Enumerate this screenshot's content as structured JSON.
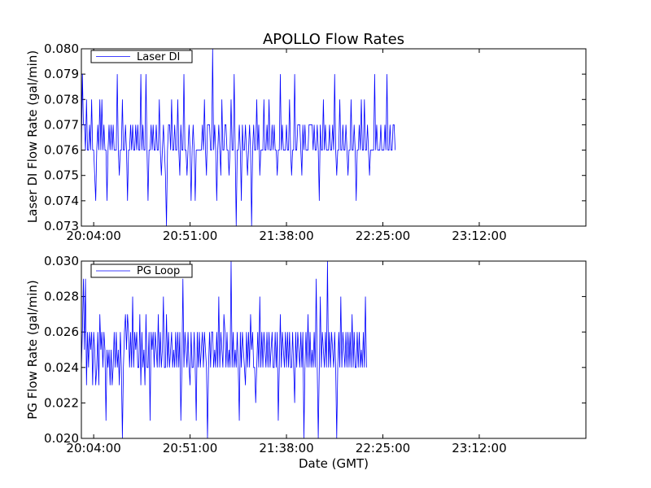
{
  "chart_data": [
    {
      "type": "line",
      "title": "APOLLO Flow Rates",
      "xlabel": "",
      "ylabel": "Laser DI Flow Rate (gal/min)",
      "ylim": [
        0.073,
        0.08
      ],
      "yticks": [
        "0.073",
        "0.074",
        "0.075",
        "0.076",
        "0.077",
        "0.078",
        "0.079",
        "0.080"
      ],
      "xlim": [
        "19:58:00",
        "00:04:00"
      ],
      "xticks": [
        "20:04:00",
        "20:51:00",
        "21:38:00",
        "22:25:00",
        "23:12:00"
      ],
      "grid": false,
      "legend": "upper-left",
      "series": [
        {
          "name": "Laser DI",
          "color": "#0000ff",
          "time_interval_min": 0.5,
          "values": [
            0.076,
            0.079,
            0.077,
            0.077,
            0.076,
            0.078,
            0.076,
            0.076,
            0.077,
            0.076,
            0.078,
            0.076,
            0.076,
            0.075,
            0.074,
            0.076,
            0.077,
            0.076,
            0.078,
            0.076,
            0.078,
            0.076,
            0.077,
            0.076,
            0.076,
            0.074,
            0.076,
            0.077,
            0.076,
            0.077,
            0.076,
            0.077,
            0.076,
            0.076,
            0.076,
            0.079,
            0.076,
            0.075,
            0.076,
            0.076,
            0.078,
            0.076,
            0.076,
            0.077,
            0.076,
            0.074,
            0.076,
            0.076,
            0.077,
            0.076,
            0.077,
            0.076,
            0.076,
            0.077,
            0.076,
            0.077,
            0.076,
            0.076,
            0.079,
            0.076,
            0.077,
            0.076,
            0.076,
            0.079,
            0.076,
            0.074,
            0.076,
            0.076,
            0.077,
            0.076,
            0.077,
            0.076,
            0.076,
            0.077,
            0.076,
            0.076,
            0.078,
            0.076,
            0.075,
            0.076,
            0.077,
            0.076,
            0.075,
            0.073,
            0.076,
            0.077,
            0.077,
            0.076,
            0.078,
            0.076,
            0.076,
            0.077,
            0.076,
            0.076,
            0.078,
            0.076,
            0.075,
            0.077,
            0.076,
            0.076,
            0.079,
            0.076,
            0.076,
            0.075,
            0.076,
            0.077,
            0.076,
            0.074,
            0.076,
            0.077,
            0.076,
            0.074,
            0.076,
            0.076,
            0.076,
            0.076,
            0.076,
            0.076,
            0.077,
            0.076,
            0.078,
            0.076,
            0.075,
            0.077,
            0.077,
            0.077,
            0.076,
            0.076,
            0.08,
            0.076,
            0.077,
            0.076,
            0.074,
            0.076,
            0.077,
            0.076,
            0.075,
            0.078,
            0.076,
            0.076,
            0.077,
            0.077,
            0.076,
            0.076,
            0.075,
            0.076,
            0.078,
            0.076,
            0.076,
            0.079,
            0.076,
            0.073,
            0.076,
            0.076,
            0.077,
            0.076,
            0.074,
            0.077,
            0.076,
            0.076,
            0.077,
            0.076,
            0.075,
            0.076,
            0.077,
            0.076,
            0.073,
            0.076,
            0.077,
            0.076,
            0.076,
            0.078,
            0.076,
            0.077,
            0.075,
            0.076,
            0.076,
            0.076,
            0.078,
            0.076,
            0.076,
            0.077,
            0.076,
            0.078,
            0.076,
            0.076,
            0.077,
            0.076,
            0.077,
            0.076,
            0.076,
            0.075,
            0.076,
            0.076,
            0.079,
            0.076,
            0.077,
            0.076,
            0.076,
            0.076,
            0.077,
            0.076,
            0.076,
            0.078,
            0.076,
            0.075,
            0.076,
            0.076,
            0.079,
            0.076,
            0.076,
            0.077,
            0.077,
            0.077,
            0.076,
            0.075,
            0.077,
            0.076,
            0.077,
            0.076,
            0.076,
            0.076,
            0.077,
            0.077,
            0.077,
            0.077,
            0.076,
            0.077,
            0.076,
            0.076,
            0.077,
            0.076,
            0.074,
            0.077,
            0.076,
            0.076,
            0.078,
            0.076,
            0.077,
            0.076,
            0.076,
            0.076,
            0.077,
            0.076,
            0.076,
            0.077,
            0.076,
            0.079,
            0.076,
            0.075,
            0.076,
            0.076,
            0.078,
            0.076,
            0.076,
            0.077,
            0.076,
            0.076,
            0.077,
            0.076,
            0.075,
            0.076,
            0.076,
            0.078,
            0.076,
            0.076,
            0.077,
            0.076,
            0.074,
            0.076,
            0.076,
            0.077,
            0.076,
            0.078,
            0.076,
            0.076,
            0.078,
            0.076,
            0.076,
            0.077,
            0.076,
            0.075,
            0.076,
            0.076,
            0.076,
            0.076,
            0.079,
            0.076,
            0.077,
            0.076,
            0.076,
            0.076,
            0.077,
            0.076,
            0.076,
            0.076,
            0.077,
            0.076,
            0.079,
            0.076,
            0.076,
            0.077,
            0.076,
            0.076,
            0.077,
            0.077,
            0.076
          ]
        }
      ]
    },
    {
      "type": "line",
      "title": "",
      "xlabel": "Date (GMT)",
      "ylabel": "PG Flow Rate (gal/min)",
      "ylim": [
        0.02,
        0.03
      ],
      "yticks": [
        "0.020",
        "0.022",
        "0.024",
        "0.026",
        "0.028",
        "0.030"
      ],
      "xlim": [
        "19:58:00",
        "00:04:00"
      ],
      "xticks": [
        "20:04:00",
        "20:51:00",
        "21:38:00",
        "22:25:00",
        "23:12:00"
      ],
      "grid": false,
      "legend": "upper-left",
      "series": [
        {
          "name": "PG Loop",
          "color": "#0000ff",
          "time_interval_min": 0.5,
          "values": [
            0.024,
            0.026,
            0.029,
            0.025,
            0.029,
            0.023,
            0.026,
            0.024,
            0.026,
            0.025,
            0.026,
            0.023,
            0.026,
            0.025,
            0.023,
            0.024,
            0.026,
            0.023,
            0.027,
            0.025,
            0.026,
            0.024,
            0.026,
            0.025,
            0.021,
            0.025,
            0.024,
            0.025,
            0.023,
            0.025,
            0.023,
            0.024,
            0.026,
            0.024,
            0.026,
            0.024,
            0.025,
            0.023,
            0.026,
            0.024,
            0.02,
            0.024,
            0.026,
            0.027,
            0.025,
            0.027,
            0.026,
            0.024,
            0.026,
            0.024,
            0.028,
            0.024,
            0.026,
            0.025,
            0.026,
            0.024,
            0.024,
            0.027,
            0.023,
            0.026,
            0.024,
            0.025,
            0.023,
            0.027,
            0.024,
            0.024,
            0.026,
            0.021,
            0.026,
            0.025,
            0.026,
            0.024,
            0.026,
            0.025,
            0.024,
            0.027,
            0.024,
            0.026,
            0.024,
            0.025,
            0.028,
            0.024,
            0.024,
            0.027,
            0.024,
            0.026,
            0.024,
            0.025,
            0.026,
            0.024,
            0.025,
            0.024,
            0.026,
            0.024,
            0.026,
            0.024,
            0.026,
            0.021,
            0.024,
            0.029,
            0.024,
            0.026,
            0.025,
            0.024,
            0.026,
            0.024,
            0.023,
            0.026,
            0.024,
            0.024,
            0.026,
            0.024,
            0.021,
            0.026,
            0.024,
            0.026,
            0.024,
            0.025,
            0.026,
            0.024,
            0.026,
            0.025,
            0.024,
            0.02,
            0.024,
            0.026,
            0.024,
            0.026,
            0.026,
            0.024,
            0.025,
            0.024,
            0.026,
            0.024,
            0.028,
            0.024,
            0.026,
            0.025,
            0.024,
            0.027,
            0.026,
            0.024,
            0.026,
            0.024,
            0.025,
            0.024,
            0.03,
            0.024,
            0.026,
            0.024,
            0.025,
            0.024,
            0.026,
            0.024,
            0.021,
            0.026,
            0.024,
            0.026,
            0.025,
            0.024,
            0.023,
            0.026,
            0.024,
            0.026,
            0.024,
            0.027,
            0.025,
            0.026,
            0.024,
            0.024,
            0.022,
            0.024,
            0.026,
            0.024,
            0.028,
            0.024,
            0.026,
            0.024,
            0.026,
            0.025,
            0.024,
            0.026,
            0.024,
            0.026,
            0.024,
            0.025,
            0.026,
            0.024,
            0.024,
            0.026,
            0.024,
            0.026,
            0.021,
            0.024,
            0.027,
            0.024,
            0.026,
            0.025,
            0.024,
            0.026,
            0.024,
            0.026,
            0.024,
            0.026,
            0.024,
            0.024,
            0.026,
            0.024,
            0.022,
            0.026,
            0.024,
            0.026,
            0.025,
            0.024,
            0.026,
            0.024,
            0.026,
            0.02,
            0.024,
            0.026,
            0.024,
            0.027,
            0.024,
            0.026,
            0.024,
            0.025,
            0.024,
            0.026,
            0.024,
            0.029,
            0.024,
            0.02,
            0.024,
            0.028,
            0.024,
            0.026,
            0.025,
            0.024,
            0.026,
            0.024,
            0.03,
            0.024,
            0.026,
            0.024,
            0.026,
            0.025,
            0.024,
            0.026,
            0.024,
            0.02,
            0.024,
            0.026,
            0.024,
            0.028,
            0.024,
            0.026,
            0.025,
            0.024,
            0.026,
            0.024,
            0.026,
            0.024,
            0.026,
            0.024,
            0.027,
            0.024,
            0.026,
            0.024,
            0.024,
            0.026,
            0.024,
            0.026,
            0.024,
            0.025,
            0.024,
            0.026,
            0.024,
            0.028,
            0.024
          ]
        }
      ]
    }
  ]
}
